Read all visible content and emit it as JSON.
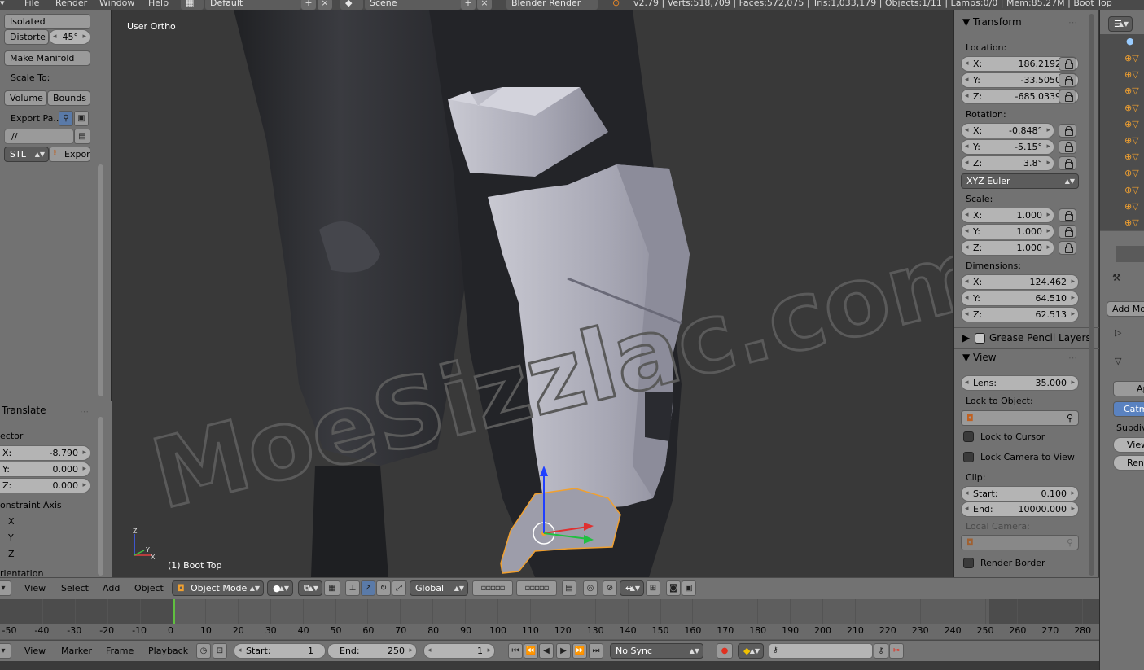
{
  "topbar": {
    "menu": [
      "File",
      "Render",
      "Window",
      "Help"
    ],
    "screen_layout": "Default",
    "scene": "Scene",
    "render_engine": "Blender Render",
    "stats": "v2.79 | Verts:518,709 | Faces:572,075 | Tris:1,033,179 | Objects:1/11 | Lamps:0/0 | Mem:85.27M | Boot Top"
  },
  "toolshelf": {
    "isolated": "Isolated",
    "distort_label": "Distorte",
    "distort_value": "45°",
    "make_manifold": "Make Manifold",
    "scale_to": "Scale To:",
    "volume": "Volume",
    "bounds": "Bounds",
    "export_path_label": "Export Pa...",
    "path_value": "//",
    "format": "STL",
    "export": "Export",
    "operator_title": "Translate",
    "vector_label": "ector",
    "vec_x_label": "X:",
    "vec_x": "-8.790",
    "vec_y_label": "Y:",
    "vec_y": "0.000",
    "vec_z_label": "Z:",
    "vec_z": "0.000",
    "constraint_label": "onstraint Axis",
    "axis_x": "X",
    "axis_y": "Y",
    "axis_z": "Z",
    "orientation_label": "rientation"
  },
  "viewport": {
    "view_label": "User Ortho",
    "object_label": "(1) Boot Top",
    "watermark": "MoeSizzlac.com",
    "axis_z": "Z",
    "axis_y": "Y",
    "axis_x": "X"
  },
  "npanel": {
    "transform_title": "Transform",
    "location_label": "Location:",
    "loc_x_label": "X:",
    "loc_x": "186.21927",
    "loc_y_label": "Y:",
    "loc_y": "-33.50507",
    "loc_z_label": "Z:",
    "loc_z": "-685.03394",
    "rotation_label": "Rotation:",
    "rot_x_label": "X:",
    "rot_x": "-0.848°",
    "rot_y_label": "Y:",
    "rot_y": "-5.15°",
    "rot_z_label": "Z:",
    "rot_z": "3.8°",
    "rotation_mode": "XYZ Euler",
    "scale_label": "Scale:",
    "sc_x_label": "X:",
    "sc_x": "1.000",
    "sc_y_label": "Y:",
    "sc_y": "1.000",
    "sc_z_label": "Z:",
    "sc_z": "1.000",
    "dimensions_label": "Dimensions:",
    "dim_x_label": "X:",
    "dim_x": "124.462",
    "dim_y_label": "Y:",
    "dim_y": "64.510",
    "dim_z_label": "Z:",
    "dim_z": "62.513",
    "grease_pencil": "Grease Pencil Layers",
    "view_title": "View",
    "lens_label": "Lens:",
    "lens": "35.000",
    "lock_to_object": "Lock to Object:",
    "lock_to_cursor": "Lock to Cursor",
    "lock_camera": "Lock Camera to View",
    "clip_label": "Clip:",
    "clip_start_label": "Start:",
    "clip_start": "0.100",
    "clip_end_label": "End:",
    "clip_end": "10000.000",
    "local_camera": "Local Camera:",
    "render_border": "Render Border"
  },
  "rightcol": {
    "add_modifier": "Add Mo",
    "ap": "Ap",
    "catmull": "Catmu",
    "subdiv": "Subdiv",
    "view": "View",
    "render": "Rend"
  },
  "view3d_header": {
    "menu": [
      "View",
      "Select",
      "Add",
      "Object"
    ],
    "mode": "Object Mode",
    "orientation": "Global"
  },
  "timeline": {
    "ticks": [
      "-50",
      "-40",
      "-30",
      "-20",
      "-10",
      "0",
      "10",
      "20",
      "30",
      "40",
      "50",
      "60",
      "70",
      "80",
      "90",
      "100",
      "110",
      "120",
      "130",
      "140",
      "150",
      "160",
      "170",
      "180",
      "190",
      "200",
      "210",
      "220",
      "230",
      "240",
      "250",
      "260",
      "270",
      "280"
    ],
    "current_frame_marker": 0
  },
  "timeline_header": {
    "menu": [
      "View",
      "Marker",
      "Frame",
      "Playback"
    ],
    "start_label": "Start:",
    "start": "1",
    "end_label": "End:",
    "end": "250",
    "current": "1",
    "sync": "No Sync"
  },
  "colors": {
    "panel_bg": "#727272",
    "viewport_bg": "#393939",
    "selection_outline": "#f0a030",
    "dropdown_bg": "#5c5c5c"
  }
}
